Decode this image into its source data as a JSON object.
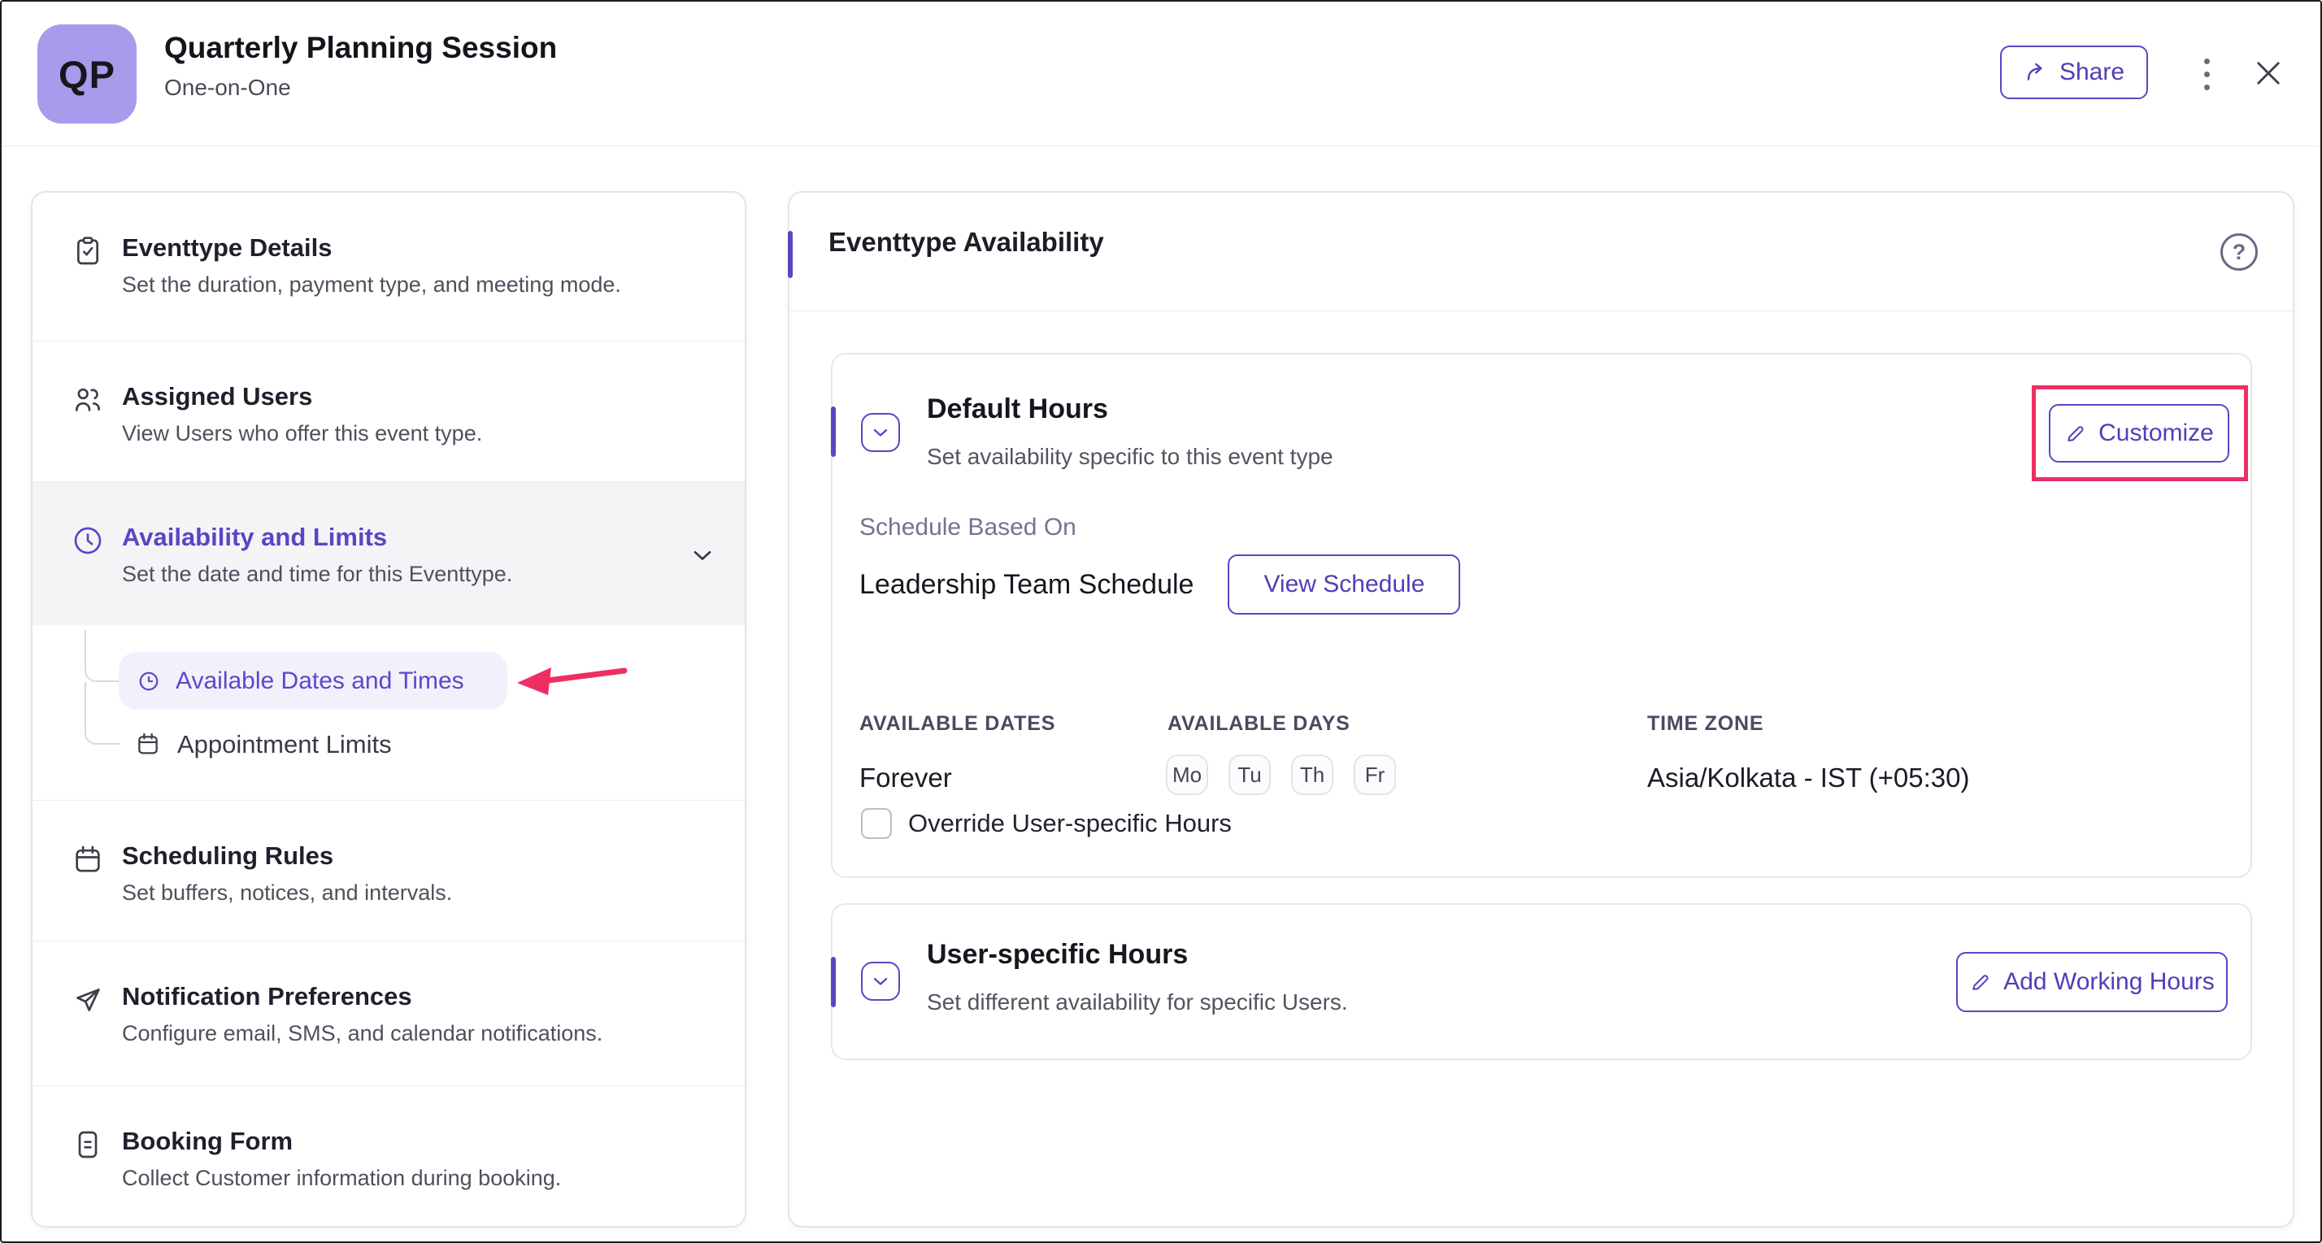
{
  "header": {
    "avatar_initials": "QP",
    "title": "Quarterly Planning Session",
    "subtitle": "One-on-One",
    "share_label": "Share"
  },
  "glyphs": {
    "help": "?"
  },
  "sidebar": {
    "items": [
      {
        "title": "Eventtype Details",
        "desc": "Set the duration, payment type, and meeting mode."
      },
      {
        "title": "Assigned Users",
        "desc": "View Users who offer this event type."
      },
      {
        "title": "Availability and Limits",
        "desc": "Set the date and time for this Eventtype."
      },
      {
        "title": "Scheduling Rules",
        "desc": "Set buffers, notices, and intervals."
      },
      {
        "title": "Notification Preferences",
        "desc": "Configure email, SMS, and calendar notifications."
      },
      {
        "title": "Booking Form",
        "desc": "Collect Customer information during booking."
      }
    ],
    "subitems": [
      {
        "label": "Available Dates and Times",
        "selected": true
      },
      {
        "label": "Appointment Limits",
        "selected": false
      }
    ]
  },
  "main": {
    "title": "Eventtype Availability",
    "default_hours": {
      "title": "Default Hours",
      "desc": "Set availability specific to this event type",
      "customize_label": "Customize",
      "schedule_based_on_label": "Schedule Based On",
      "schedule_name": "Leadership Team Schedule",
      "view_schedule_label": "View Schedule",
      "dates_label": "AVAILABLE DATES",
      "days_label": "AVAILABLE DAYS",
      "timezone_label": "TIME ZONE",
      "dates_value": "Forever",
      "days": [
        "Mo",
        "Tu",
        "Th",
        "Fr"
      ],
      "timezone_value": "Asia/Kolkata - IST (+05:30)",
      "override_label": "Override User-specific Hours",
      "override_checked": false
    },
    "user_hours": {
      "title": "User-specific Hours",
      "desc": "Set different availability for specific Users.",
      "add_label": "Add Working Hours"
    }
  },
  "colors": {
    "accent_purple": "#5847c4",
    "annotation_red": "#ee2e62",
    "avatar_bg": "#a89bec",
    "active_row_bg": "#f4f4f7",
    "pill_bg": "#f2f1fb"
  }
}
